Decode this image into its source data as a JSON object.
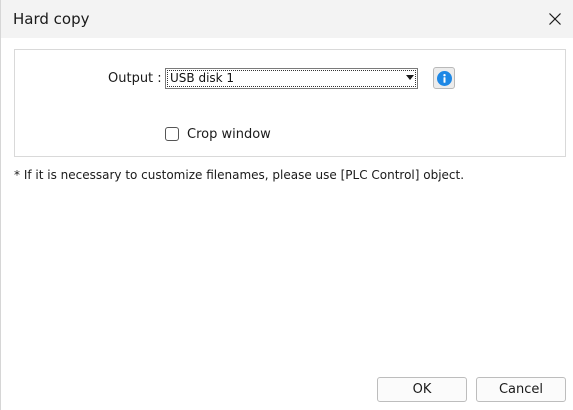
{
  "window": {
    "title": "Hard copy",
    "close_icon": "close-icon"
  },
  "form": {
    "output_label": "Output :",
    "output_value": "USB disk 1",
    "info_icon": "info-icon",
    "crop_window_label": "Crop window",
    "crop_window_checked": false
  },
  "note": "* If it is necessary to customize filenames, please use [PLC Control] object.",
  "buttons": {
    "ok_label": "OK",
    "cancel_label": "Cancel"
  },
  "colors": {
    "info_accent": "#1e88e5"
  }
}
